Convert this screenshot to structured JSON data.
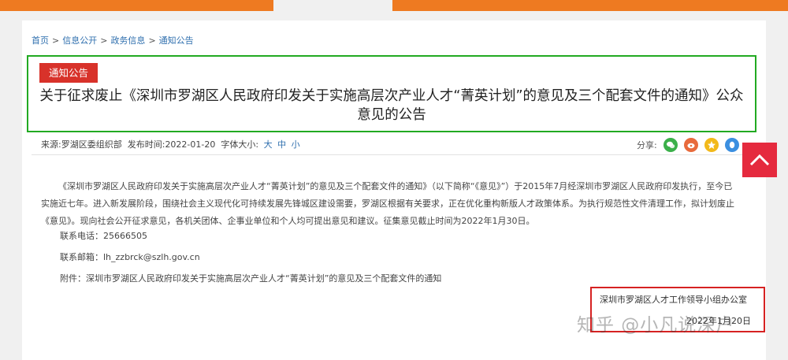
{
  "breadcrumb": [
    "首页",
    "信息公开",
    "政务信息",
    "通知公告"
  ],
  "notice": {
    "category": "通知公告",
    "title": "关于征求废止《深圳市罗湖区人民政府印发关于实施高层次产业人才“菁英计划”的意见及三个配套文件的通知》公众意见的公告"
  },
  "meta": {
    "source_label": "来源:",
    "source": "罗湖区委组织部",
    "time_label": "发布时间:",
    "time": "2022-01-20",
    "font_label": "字体大小:",
    "font_sizes": [
      "大",
      "中",
      "小"
    ]
  },
  "share": {
    "label": "分享:",
    "icons": [
      "wechat-icon",
      "weibo-icon",
      "qzone-icon",
      "qq-icon"
    ]
  },
  "content": {
    "paragraph": "《深圳市罗湖区人民政府印发关于实施高层次产业人才“菁英计划”的意见及三个配套文件的通知》（以下简称“《意见》”）于2015年7月经深圳市罗湖区人民政府印发执行，至今已实施近七年。进入新发展阶段，围绕社会主义现代化可持续发展先锋城区建设需要，罗湖区根据有关要求，正在优化重构新版人才政策体系。为执行规范性文件清理工作，拟计划废止《意见》。现向社会公开征求意见，各机关团体、企事业单位和个人均可提出意见和建议。征集意见截止时间为2022年1月30日。",
    "phone": "联系电话：25666505",
    "email": "联系邮箱：lh_zzbrck@szlh.gov.cn",
    "attachment": "附件：深圳市罗湖区人民政府印发关于实施高层次产业人才“菁英计划”的意见及三个配套文件的通知"
  },
  "signature": {
    "org": "深圳市罗湖区人才工作领导小组办公室",
    "date": "2022年1月20日"
  },
  "watermark": "知乎 @小凡说深户",
  "colors": {
    "accent_orange": "#ee7a21",
    "tag_red": "#d8322a",
    "highlight_green": "#22aa22",
    "highlight_red": "#d62222",
    "link_blue": "#2f6fae"
  }
}
